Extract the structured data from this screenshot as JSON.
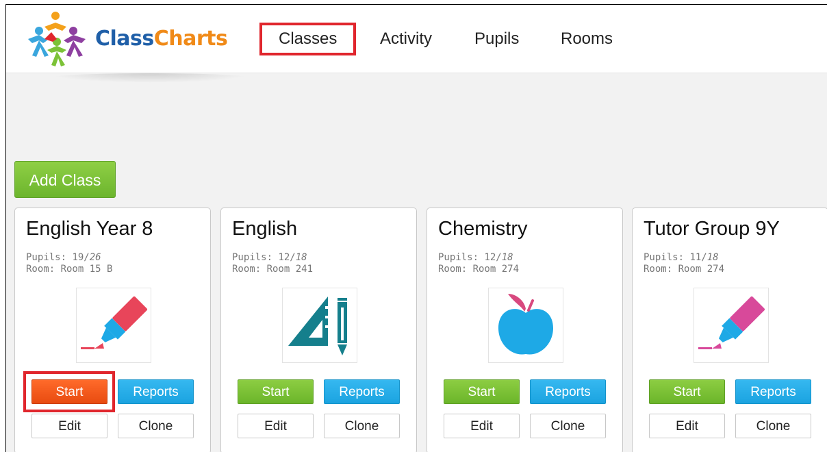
{
  "app": {
    "logo_part1": "Class",
    "logo_part2": "Charts"
  },
  "nav": {
    "items": [
      {
        "label": "Classes",
        "active": true
      },
      {
        "label": "Activity",
        "active": false
      },
      {
        "label": "Pupils",
        "active": false
      },
      {
        "label": "Rooms",
        "active": false
      }
    ]
  },
  "add_class_label": "Add Class",
  "cards": [
    {
      "title": "English Year 8",
      "pupils_label": "Pupils: ",
      "pupils_present": "19",
      "pupils_total": "26",
      "room": "Room: Room 15 B",
      "icon": "highlighter-icon",
      "start_label": "Start",
      "reports_label": "Reports",
      "edit_label": "Edit",
      "clone_label": "Clone",
      "start_highlighted": true
    },
    {
      "title": "English",
      "pupils_label": "Pupils: ",
      "pupils_present": "12",
      "pupils_total": "18",
      "room": "Room: Room 241",
      "icon": "set-square-pencil-icon",
      "start_label": "Start",
      "reports_label": "Reports",
      "edit_label": "Edit",
      "clone_label": "Clone",
      "start_highlighted": false
    },
    {
      "title": "Chemistry",
      "pupils_label": "Pupils: ",
      "pupils_present": "12",
      "pupils_total": "18",
      "room": "Room: Room 274",
      "icon": "apple-icon",
      "start_label": "Start",
      "reports_label": "Reports",
      "edit_label": "Edit",
      "clone_label": "Clone",
      "start_highlighted": false
    },
    {
      "title": "Tutor Group 9Y",
      "pupils_label": "Pupils: ",
      "pupils_present": "11",
      "pupils_total": "18",
      "room": "Room: Room 274",
      "icon": "highlighter-icon",
      "start_label": "Start",
      "reports_label": "Reports",
      "edit_label": "Edit",
      "clone_label": "Clone",
      "start_highlighted": false
    }
  ],
  "colors": {
    "accent_red": "#e0262d",
    "start_green": "#7cc237",
    "start_active": "#f05a1a",
    "reports_blue": "#1ea9e6",
    "brand_blue": "#1f5fa8",
    "brand_orange": "#f08a18"
  }
}
